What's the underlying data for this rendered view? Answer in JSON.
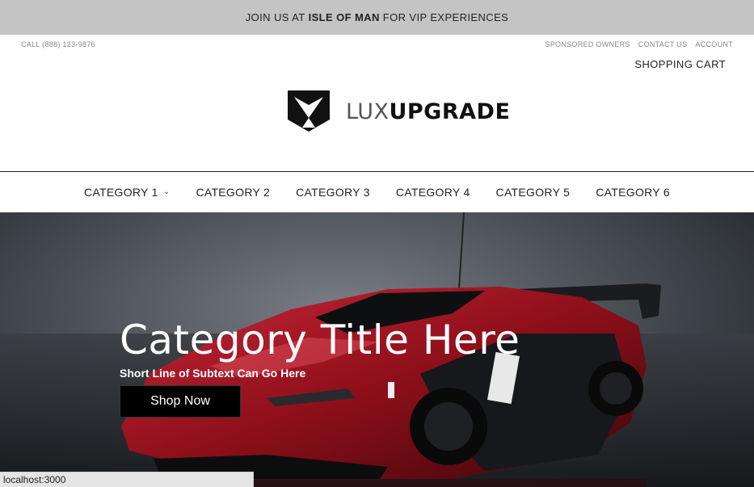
{
  "announcement": {
    "prefix": "JOIN US AT",
    "highlight": "ISLE OF MAN",
    "suffix": "FOR VIP EXPERIENCES"
  },
  "header": {
    "phone": "CALL (888) 123-9876",
    "utility_links": [
      "SPONSORED OWNERS",
      "CONTACT US",
      "ACCOUNT"
    ],
    "cart_label": "SHOPPING CART"
  },
  "logo": {
    "text_light": "LUX",
    "text_bold": "UPGRADE"
  },
  "nav": {
    "items": [
      "CATEGORY 1",
      "CATEGORY 2",
      "CATEGORY 3",
      "CATEGORY 4",
      "CATEGORY 5",
      "CATEGORY 6"
    ],
    "dropdown_icon": "chevron-down-icon"
  },
  "hero": {
    "title": "Category Title Here",
    "subtitle": "Short Line of Subtext Can Go Here",
    "button_label": "Shop Now"
  },
  "status_bar": {
    "url": "localhost:3000"
  },
  "colors": {
    "announcement_bg": "#c4c4c4",
    "button_bg": "#000000",
    "car_red": "#a0121c"
  }
}
